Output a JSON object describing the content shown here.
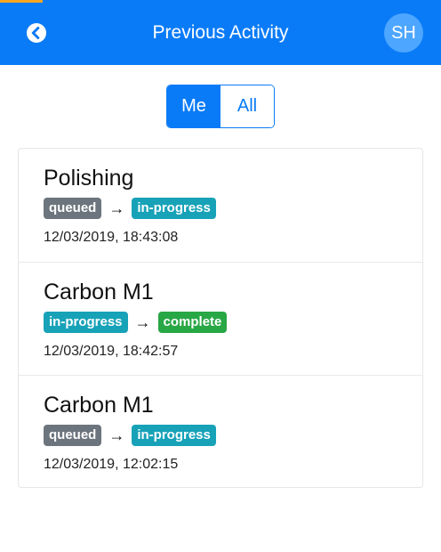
{
  "colors": {
    "header_bg": "#0a7bf7",
    "avatar_bg": "#4da6ff",
    "status_accent": "#f5a623",
    "badge_queued": "#6c757d",
    "badge_in_progress": "#17a2b8",
    "badge_complete": "#28a745"
  },
  "header": {
    "back_icon": "chevron-left-circle-icon",
    "title": "Previous Activity",
    "avatar_initials": "SH"
  },
  "filter": {
    "options": [
      {
        "label": "Me",
        "active": true
      },
      {
        "label": "All",
        "active": false
      }
    ]
  },
  "activities": [
    {
      "title": "Polishing",
      "from": "queued",
      "to": "in-progress",
      "timestamp": "12/03/2019, 18:43:08"
    },
    {
      "title": "Carbon M1",
      "from": "in-progress",
      "to": "complete",
      "timestamp": "12/03/2019, 18:42:57"
    },
    {
      "title": "Carbon M1",
      "from": "queued",
      "to": "in-progress",
      "timestamp": "12/03/2019, 12:02:15"
    }
  ],
  "transition_arrow": "→"
}
